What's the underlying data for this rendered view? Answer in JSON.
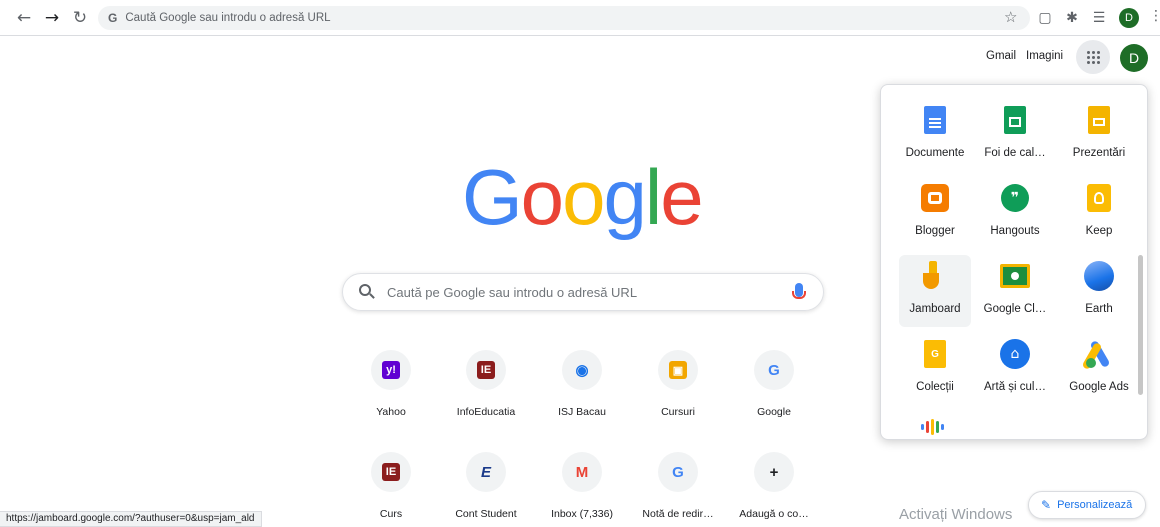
{
  "browser": {
    "address_placeholder": "Caută Google sau introdu o adresă URL",
    "omnibox_icon": "G",
    "avatar_letter": "D",
    "status_url": "https://jamboard.google.com/?authuser=0&usp=jam_ald"
  },
  "header": {
    "gmail": "Gmail",
    "images": "Imagini",
    "avatar_letter": "D"
  },
  "logo": {
    "letters": [
      "G",
      "o",
      "o",
      "g",
      "l",
      "e"
    ],
    "colors": [
      "#4285f4",
      "#ea4335",
      "#fbbc05",
      "#4285f4",
      "#34a853",
      "#ea4335"
    ]
  },
  "search": {
    "placeholder": "Caută pe Google sau introdu o adresă URL"
  },
  "shortcuts": [
    {
      "label": "Yahoo",
      "icon": "y!",
      "icon_color": "#6001d2"
    },
    {
      "label": "InfoEducatia",
      "icon": "IE",
      "icon_color": "#8b1d1d"
    },
    {
      "label": "ISJ Bacau",
      "icon": "◉",
      "icon_color": "#1a73e8"
    },
    {
      "label": "Cursuri",
      "icon": "▣",
      "icon_color": "#f2a600"
    },
    {
      "label": "Google",
      "icon": "G",
      "icon_color": "#4285f4"
    },
    {
      "label": "Curs",
      "icon": "IE",
      "icon_color": "#8b1d1d"
    },
    {
      "label": "Cont Student",
      "icon": "E",
      "icon_color": "#1a3a8a"
    },
    {
      "label": "Inbox (7,336)",
      "icon": "M",
      "icon_color": "#ea4335"
    },
    {
      "label": "Notă de redir…",
      "icon": "G",
      "icon_color": "#4285f4"
    },
    {
      "label": "Adaugă o co…",
      "icon": "+",
      "icon_color": "#202124"
    }
  ],
  "apps": [
    {
      "label": "Documente",
      "icon": "docs-icon",
      "color": "#4285f4"
    },
    {
      "label": "Foi de cal…",
      "icon": "sheets-icon",
      "color": "#0f9d58"
    },
    {
      "label": "Prezentări",
      "icon": "slides-icon",
      "color": "#f4b400"
    },
    {
      "label": "Blogger",
      "icon": "blogger-icon",
      "color": "#f57c00"
    },
    {
      "label": "Hangouts",
      "icon": "hangouts-icon",
      "color": "#0f9d58"
    },
    {
      "label": "Keep",
      "icon": "keep-icon",
      "color": "#fbbc04"
    },
    {
      "label": "Jamboard",
      "icon": "jamboard-icon",
      "color": "#f4b400"
    },
    {
      "label": "Google Cl…",
      "icon": "classroom-icon",
      "color": "#0f9d58"
    },
    {
      "label": "Earth",
      "icon": "earth-icon",
      "color": "#4285f4"
    },
    {
      "label": "Colecții",
      "icon": "collections-icon",
      "color": "#fbbc04"
    },
    {
      "label": "Artă și cul…",
      "icon": "arts-culture-icon",
      "color": "#1a73e8"
    },
    {
      "label": "Google Ads",
      "icon": "ads-icon",
      "color": "#4285f4"
    }
  ],
  "footer": {
    "watermark": "Activați Windows",
    "customize": "Personalizează"
  }
}
